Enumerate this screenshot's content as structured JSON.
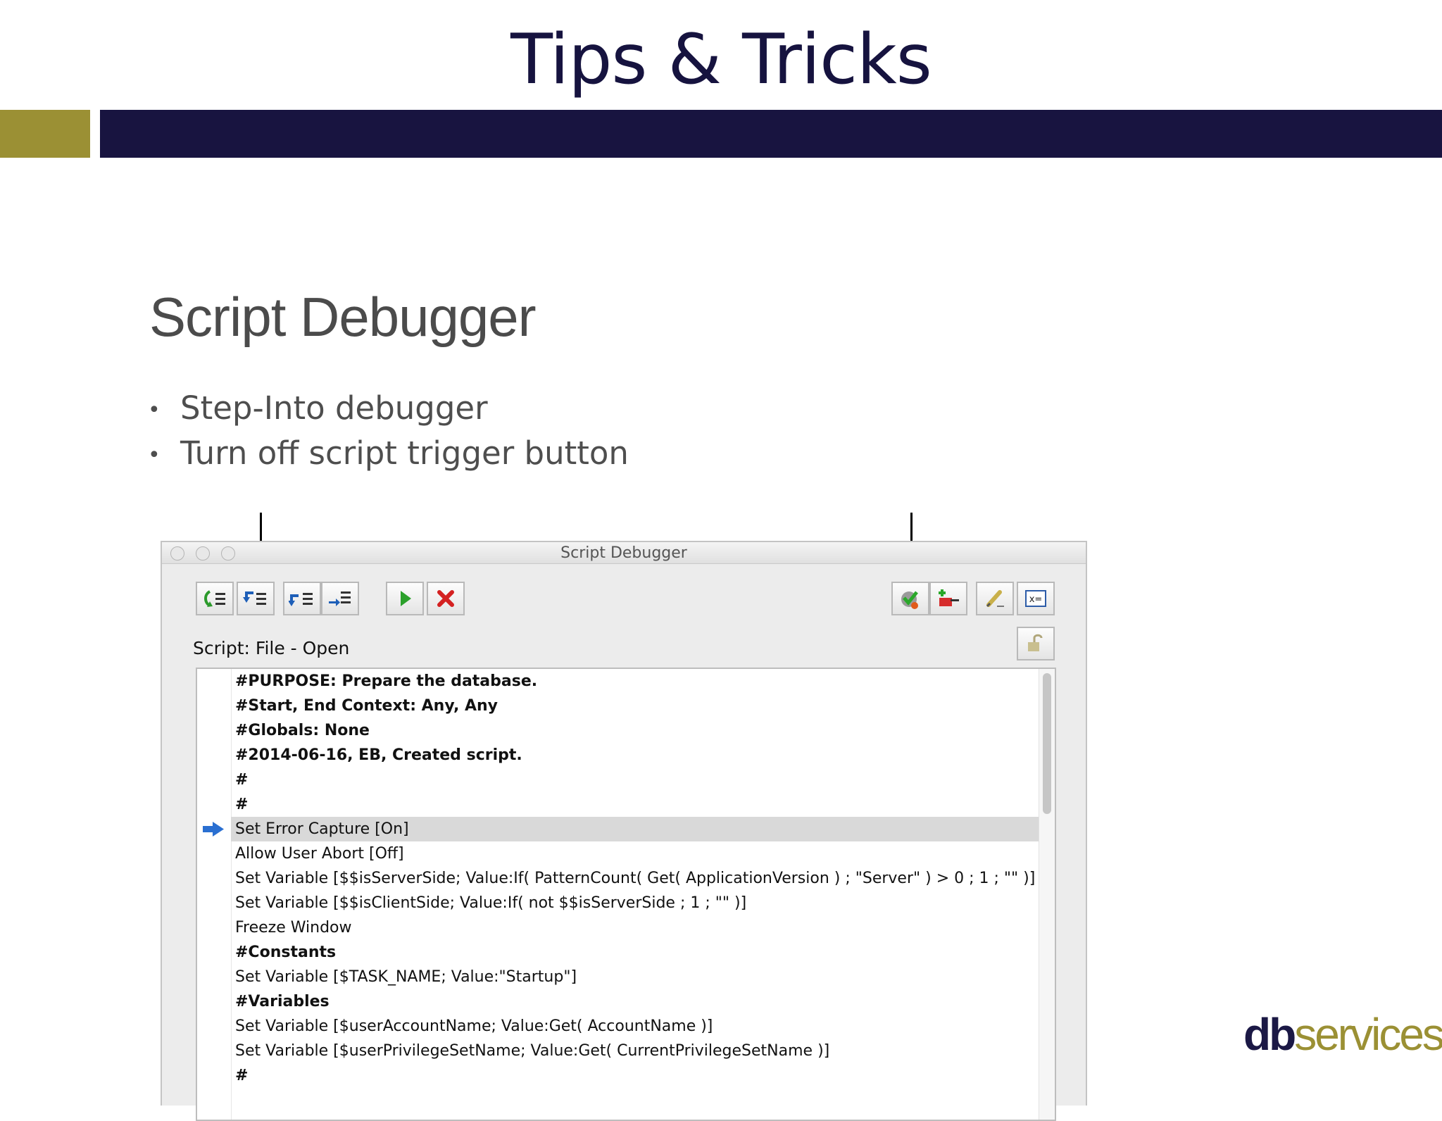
{
  "slide": {
    "title": "Tips & Tricks",
    "subtitle": "Script Debugger",
    "bullets": [
      "Step-Into debugger",
      "Turn off script trigger button"
    ],
    "logo": {
      "part1": "db",
      "part2": "services"
    }
  },
  "colors": {
    "navy": "#181440",
    "gold": "#9b9034",
    "highlight": "#d9d9d9"
  },
  "window": {
    "title": "Script Debugger",
    "toolbar_icons": [
      "step-out-icon",
      "step-into-icon",
      "step-over-icon",
      "set-next-step-icon",
      "run-icon",
      "halt-icon",
      "pause-on-error-icon",
      "disable-script-triggers-icon",
      "edit-script-icon",
      "data-viewer-icon",
      "lock-icon"
    ],
    "script_label": "Script: File - Open",
    "rows": [
      "#PURPOSE: Prepare the database.",
      "#Start, End Context: Any, Any",
      "#Globals: None",
      "#2014-06-16, EB, Created script.",
      "#",
      "#",
      "Set Error Capture [On]",
      "Allow User Abort [Off]",
      "Set Variable [$$isServerSide; Value:If( PatternCount( Get( ApplicationVersion ) ; \"Server\" ) > 0 ; 1 ; \"\" )]",
      "Set Variable [$$isClientSide; Value:If( not $$isServerSide ; 1 ; \"\" )]",
      "Freeze Window",
      "#Constants",
      "Set Variable [$TASK_NAME; Value:\"Startup\"]",
      "#Variables",
      "Set Variable [$userAccountName; Value:Get( AccountName )]",
      "Set Variable [$userPrivilegeSetName; Value:Get( CurrentPrivilegeSetName )]",
      "#"
    ]
  }
}
